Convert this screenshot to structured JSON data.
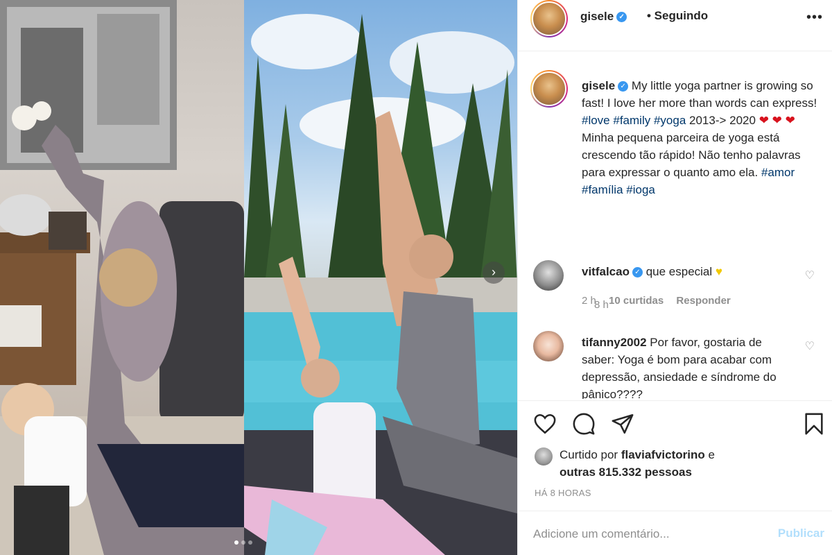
{
  "post": {
    "username": "gisele",
    "verified_icon": "check-icon",
    "following_label": "• Seguindo",
    "more_label": "•••"
  },
  "caption": {
    "username": "gisele",
    "text_1": " My little yoga partner is growing so fast! I love her more than words can express! ",
    "tag_love": "#love",
    "tag_family": "#family",
    "tag_yoga": "#yoga",
    "text_2": " 2013-> 2020 ",
    "hearts": "❤ ❤ ❤",
    "text_3": " Minha pequena parceira de yoga está crescendo tão rápido! Não tenho palavras para expressar o quanto amo ela. ",
    "tag_amor": "#amor",
    "tag_familia": "#família",
    "tag_ioga": "#ioga",
    "time": "8 h"
  },
  "comments": [
    {
      "username": "vitfalcao",
      "text": " que especial ",
      "emoji": "♥",
      "time": "2 h",
      "likes": "10 curtidas",
      "reply": "Responder"
    },
    {
      "username": "tifanny2002",
      "text": " Por favor, gostaria de saber: Yoga é bom para acabar com depressão, ansiedade e síndrome do pânico????"
    }
  ],
  "likes": {
    "prefix": "Curtido por ",
    "user": "flaviafvictorino",
    "middle": " e",
    "others": "outras 815.332 pessoas"
  },
  "post_time": "HÁ 8 HORAS",
  "add_comment": {
    "placeholder": "Adicione um comentário...",
    "publish_label": "Publicar"
  },
  "media": {
    "next_label": "›",
    "carousel_total": 3,
    "carousel_active": 1
  },
  "colors": {
    "verified": "#3897f0",
    "hashtag": "#00376b",
    "publish_disabled": "#b2dffc",
    "meta_gray": "#8e8e8e"
  }
}
